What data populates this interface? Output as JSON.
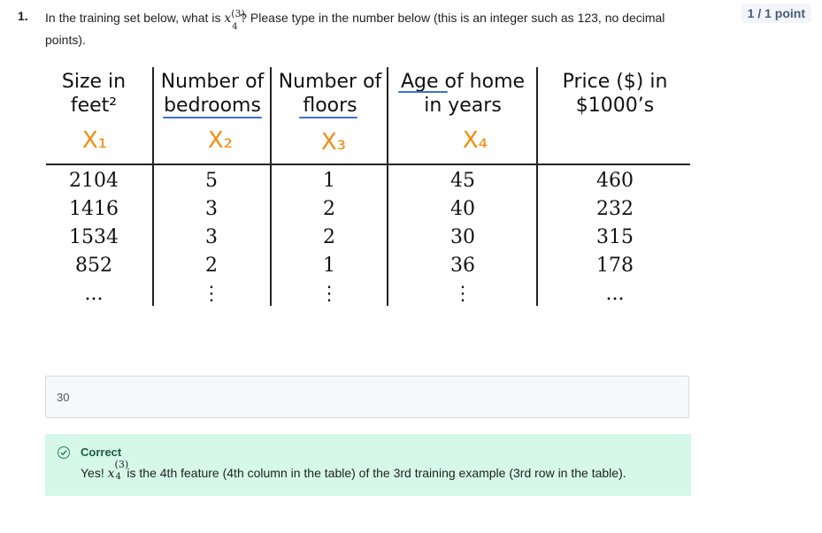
{
  "question": {
    "number": "1.",
    "text_before": "In the training set below, what is ",
    "var": "x",
    "sup": "(3)",
    "sub": "4",
    "text_after": "? Please type in the number below (this is an integer such as 123, no decimal points)."
  },
  "points": "1 / 1 point",
  "table": {
    "headers": [
      {
        "line1": "Size in",
        "line2": "feet²"
      },
      {
        "line1": "Number of",
        "line2": "bedrooms"
      },
      {
        "line1": "Number of",
        "line2": "floors"
      },
      {
        "line1": "Age of home",
        "line2": "in years"
      },
      {
        "line1": "Price ($) in",
        "line2": "$1000’s"
      }
    ],
    "handwritten": [
      "X₁",
      "X₂",
      "X₃",
      "X₄"
    ],
    "rows": [
      [
        "2104",
        "5",
        "1",
        "45",
        "460"
      ],
      [
        "1416",
        "3",
        "2",
        "40",
        "232"
      ],
      [
        "1534",
        "3",
        "2",
        "30",
        "315"
      ],
      [
        "852",
        "2",
        "1",
        "36",
        "178"
      ],
      [
        "...",
        "⋮",
        "⋮",
        "⋮",
        "..."
      ]
    ],
    "handwritten_color": "#f28c0f",
    "underline_color": "#3b6fd1"
  },
  "answer": {
    "value": "30"
  },
  "feedback": {
    "status": "Correct",
    "text_before": "Yes! ",
    "var": "x",
    "sup": "(3)",
    "sub": "4",
    "text_after": " is the 4th feature (4th column in the table) of the 3rd training example (3rd row in the table).",
    "bg_color": "#d5f8ea",
    "icon": "check-circle-icon"
  }
}
